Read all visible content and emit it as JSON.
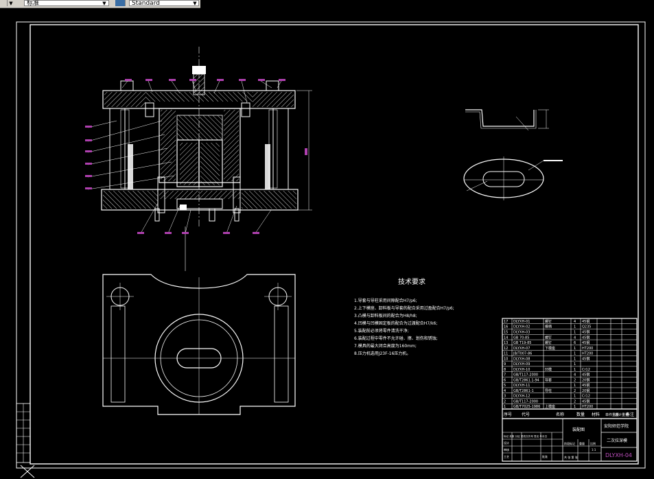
{
  "toolbar": {
    "layer_combo_value": "标准",
    "style_combo_value": "Standard"
  },
  "drawing": {
    "tech_title": "技术要求",
    "tech_notes": [
      "1.导套与导柱采用间隙配合H7/p6;",
      "2.上下模座、卸料板与导套的配合采用过盈配合H7/p6;",
      "3.凸模与卸料板间的配合为H8/h8;",
      "4.凹模与凹模固定板的配合为过渡配合H7/k6;",
      "5.装配前必须将零件清洗干净;",
      "6.装配过程中零件不允许碰、擦、划伤和锈蚀;",
      "7.模具的最大闭合高度为160mm;",
      "8.压力机选用J23F-16压力机。"
    ],
    "bom_rows": [
      {
        "no": "17",
        "code": "DLYXH-01",
        "name": "螺钉",
        "qty": "4",
        "mat": "45钢"
      },
      {
        "no": "16",
        "code": "DLYXH-02",
        "name": "模柄",
        "qty": "1",
        "mat": "Q235"
      },
      {
        "no": "15",
        "code": "DLYXH-03",
        "name": "",
        "qty": "1",
        "mat": "45钢"
      },
      {
        "no": "14",
        "code": "GB 70-85",
        "name": "螺钉",
        "qty": "4",
        "mat": "45钢"
      },
      {
        "no": "13",
        "code": "GB T19-85",
        "name": "螺钉",
        "qty": "6",
        "mat": "45钢"
      },
      {
        "no": "12",
        "code": "DLYXH-07",
        "name": "下模座",
        "qty": "1",
        "mat": "HT200"
      },
      {
        "no": "11",
        "code": "JB/T007-86",
        "name": "",
        "qty": "1",
        "mat": "HT200"
      },
      {
        "no": "10",
        "code": "DLYXH-08",
        "name": "",
        "qty": "1",
        "mat": "45钢"
      },
      {
        "no": "9",
        "code": "DLYXH-09",
        "name": "",
        "qty": "1",
        "mat": ""
      },
      {
        "no": "8",
        "code": "DLYXH-10",
        "name": "凹模",
        "qty": "1",
        "mat": "Cr12"
      },
      {
        "no": "7",
        "code": "GB/T117-2000",
        "name": "",
        "qty": "4",
        "mat": "45钢"
      },
      {
        "no": "6",
        "code": "GB/T2861.1-94",
        "name": "导套",
        "qty": "2",
        "mat": "20钢"
      },
      {
        "no": "5",
        "code": "DLYXH-11",
        "name": "",
        "qty": "1",
        "mat": "45钢"
      },
      {
        "no": "4",
        "code": "GB/T2861-1",
        "name": "导柱",
        "qty": "2",
        "mat": "20钢"
      },
      {
        "no": "3",
        "code": "DLYXH-12",
        "name": "",
        "qty": "1",
        "mat": "Cr12"
      },
      {
        "no": "2",
        "code": "GB/T117-2000",
        "name": "",
        "qty": "2",
        "mat": "45钢"
      },
      {
        "no": "1",
        "code": "GB/T7025-1986",
        "name": "上模座",
        "qty": "1",
        "mat": "HT200"
      }
    ],
    "bom_header": [
      "序号",
      "代号",
      "名称",
      "数量",
      "材料",
      "单件重量",
      "总计重量",
      "备注"
    ],
    "title_block": {
      "school": "安阳师范学院",
      "part_name": "装配图",
      "part_desc": "二次拉深模",
      "drawing_no": "DLYXH-04",
      "scale_label": "比例",
      "scale_value": "1:1",
      "sheet_label": "共 张 第 张",
      "weight_label": "重量",
      "stage_label": "阶段标记",
      "designer_row": "标记 处数 分区 更改文件号 签名 年月日",
      "sign_labels": [
        "设计",
        "审核",
        "工艺",
        "批准"
      ]
    }
  }
}
